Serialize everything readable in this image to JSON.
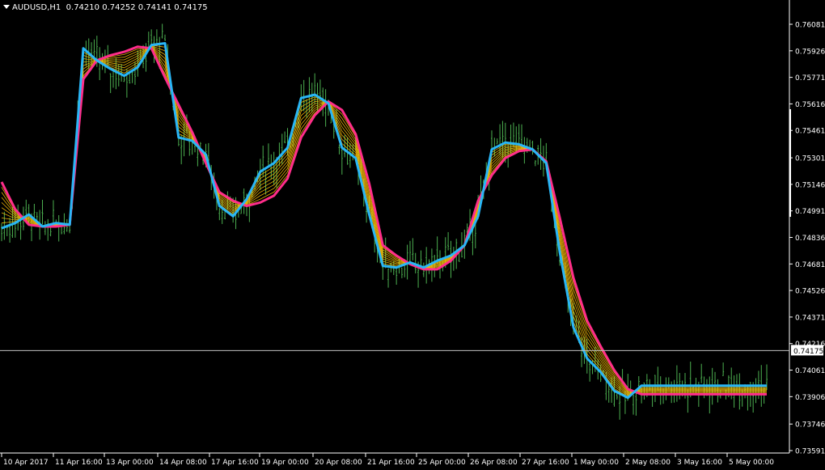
{
  "header": {
    "symbol": "AUDUSD,H1",
    "open": "0.74210",
    "high": "0.74252",
    "low": "0.74141",
    "close": "0.74175"
  },
  "colors": {
    "background": "#000000",
    "axis": "#ffffff",
    "candles": "#4caf50",
    "fast_ma": "#29b6f6",
    "slow_ma": "#ff2d8a",
    "ribbon": "#ffc107",
    "price_line": "#c0c0c0"
  },
  "chart_data": {
    "type": "line",
    "title": "AUDUSD,H1",
    "price_axis_ticks": [
      "0.76081",
      "0.75926",
      "0.75771",
      "0.75616",
      "0.75461",
      "0.75301",
      "0.75146",
      "0.74991",
      "0.74836",
      "0.74681",
      "0.74526",
      "0.74371",
      "0.74216",
      "0.74061",
      "0.73906",
      "0.73746",
      "0.73591"
    ],
    "time_axis_ticks": [
      "10 Apr 2017",
      "11 Apr 16:00",
      "13 Apr 00:00",
      "14 Apr 08:00",
      "17 Apr 16:00",
      "19 Apr 00:00",
      "20 Apr 08:00",
      "21 Apr 16:00",
      "25 Apr 00:00",
      "26 Apr 08:00",
      "27 Apr 16:00",
      "1 May 00:00",
      "2 May 08:00",
      "3 May 16:00",
      "5 May 00:00"
    ],
    "ylim": [
      0.7355,
      0.7619
    ],
    "current_price": "0.74175",
    "grid": false,
    "series": [
      {
        "role": "fast",
        "x": [
          0,
          5,
          10,
          15,
          20,
          25,
          30,
          35,
          40,
          45,
          50,
          55,
          60,
          65,
          70,
          75,
          80,
          85,
          90,
          95,
          100,
          105,
          110,
          115,
          120,
          125,
          130,
          135,
          140,
          145,
          150,
          155,
          160,
          165,
          170,
          175,
          180,
          185,
          190,
          195,
          200,
          205,
          210,
          215,
          220,
          225,
          230,
          235,
          240,
          245,
          250,
          255,
          260,
          265,
          270,
          275,
          280,
          281
        ],
        "values": [
          0.7489,
          0.7492,
          0.7497,
          0.749,
          0.7492,
          0.7491,
          0.7594,
          0.7587,
          0.7582,
          0.7578,
          0.7583,
          0.7596,
          0.7597,
          0.7542,
          0.754,
          0.7532,
          0.7502,
          0.7496,
          0.7506,
          0.7522,
          0.7527,
          0.7536,
          0.7565,
          0.7567,
          0.7562,
          0.7536,
          0.753,
          0.7497,
          0.7467,
          0.7466,
          0.7469,
          0.7466,
          0.747,
          0.7473,
          0.7479,
          0.7496,
          0.7535,
          0.7539,
          0.7538,
          0.7535,
          0.7527,
          0.7475,
          0.7431,
          0.7413,
          0.7405,
          0.7394,
          0.739,
          0.7397,
          0.7397,
          0.7397,
          0.7397,
          0.7397,
          0.7397,
          0.7397,
          0.7397,
          0.7397,
          0.7397,
          0.7397
        ]
      },
      {
        "role": "slow",
        "x": [
          0,
          5,
          10,
          15,
          20,
          25,
          30,
          35,
          40,
          45,
          50,
          55,
          60,
          65,
          70,
          75,
          80,
          85,
          90,
          95,
          100,
          105,
          110,
          115,
          120,
          125,
          130,
          135,
          140,
          145,
          150,
          155,
          160,
          165,
          170,
          175,
          180,
          185,
          190,
          195,
          200,
          205,
          210,
          215,
          220,
          225,
          230,
          235,
          240,
          245,
          250,
          255,
          260,
          265,
          270,
          275,
          280,
          281
        ],
        "values": [
          0.7516,
          0.75,
          0.7491,
          0.749,
          0.749,
          0.7491,
          0.7576,
          0.7587,
          0.759,
          0.7592,
          0.7595,
          0.7594,
          0.7577,
          0.7561,
          0.7545,
          0.7527,
          0.751,
          0.7505,
          0.7502,
          0.7504,
          0.7508,
          0.7518,
          0.7542,
          0.7555,
          0.7563,
          0.7558,
          0.7544,
          0.7515,
          0.7479,
          0.7473,
          0.7468,
          0.7465,
          0.7465,
          0.747,
          0.7479,
          0.7505,
          0.752,
          0.753,
          0.7534,
          0.7535,
          0.7528,
          0.7495,
          0.746,
          0.7435,
          0.742,
          0.7406,
          0.7395,
          0.7392,
          0.7392,
          0.7392,
          0.7392,
          0.7392,
          0.7392,
          0.7392,
          0.7392,
          0.7392,
          0.7392,
          0.7392
        ]
      }
    ]
  }
}
